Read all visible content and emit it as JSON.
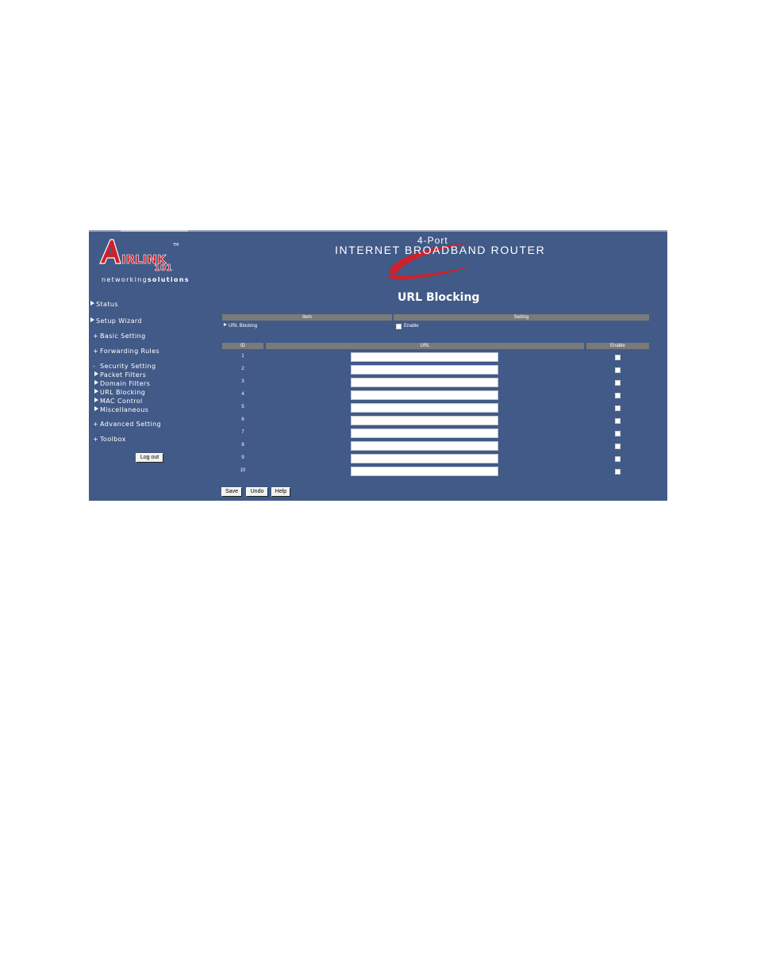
{
  "logo": {
    "brand_main": "IRLINK",
    "brand_initial": "A",
    "brand_number": "101",
    "tagline_a": "networking",
    "tagline_b": "solutions"
  },
  "banner": {
    "top_line": "4-Port",
    "main_line": "INTERNET BROADBAND ROUTER"
  },
  "sidebar": {
    "items": [
      {
        "label": "Status",
        "marker": "triangle"
      },
      {
        "label": "Setup Wizard",
        "marker": "triangle"
      },
      {
        "label": "Basic Setting",
        "marker": "+"
      },
      {
        "label": "Forwarding Rules",
        "marker": "+"
      },
      {
        "label": "Security Setting",
        "marker": "-"
      },
      {
        "label": "Advanced Setting",
        "marker": "+"
      },
      {
        "label": "Toolbox",
        "marker": "+"
      }
    ],
    "security_sub": [
      "Packet Filters",
      "Domain Filters",
      "URL Blocking",
      "MAC Control",
      "Miscellaneous"
    ],
    "logout_label": "Log out"
  },
  "main": {
    "title": "URL Blocking",
    "settings_table": {
      "headers": [
        "Item",
        "Setting"
      ],
      "row_label": "URL Blocking",
      "enable_label": "Enable",
      "enabled": false
    },
    "url_table": {
      "headers": [
        "ID",
        "URL",
        "Enable"
      ],
      "rows": [
        {
          "id": "1",
          "url": "",
          "enabled": false
        },
        {
          "id": "2",
          "url": "",
          "enabled": false
        },
        {
          "id": "3",
          "url": "",
          "enabled": false
        },
        {
          "id": "4",
          "url": "",
          "enabled": false
        },
        {
          "id": "5",
          "url": "",
          "enabled": false
        },
        {
          "id": "6",
          "url": "",
          "enabled": false
        },
        {
          "id": "7",
          "url": "",
          "enabled": false
        },
        {
          "id": "8",
          "url": "",
          "enabled": false
        },
        {
          "id": "9",
          "url": "",
          "enabled": false
        },
        {
          "id": "10",
          "url": "",
          "enabled": false
        }
      ]
    },
    "buttons": {
      "save": "Save",
      "undo": "Undo",
      "help": "Help"
    }
  },
  "colors": {
    "background": "#415a87",
    "header": "#7a7a7a",
    "brand_red": "#d0202a"
  }
}
